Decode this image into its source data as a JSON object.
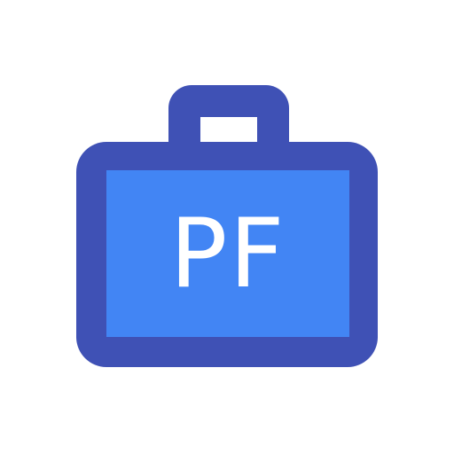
{
  "app_icon": {
    "name": "briefcase-icon",
    "label": "PF",
    "colors": {
      "outline": "#3F51B5",
      "fill": "#4285F4",
      "text": "#FFFFFF",
      "background": "#FFFFFF"
    }
  }
}
